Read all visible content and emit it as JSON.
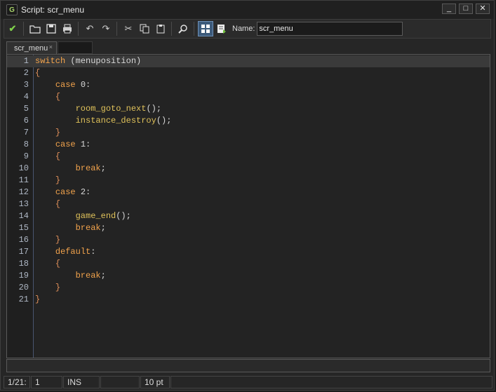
{
  "window": {
    "title": "Script: scr_menu",
    "buttons": [
      "_",
      "□",
      "✕"
    ]
  },
  "toolbar": {
    "name_label": "Name:",
    "name_value": "scr_menu"
  },
  "tabs": [
    {
      "label": "scr_menu",
      "close": "×"
    }
  ],
  "editor": {
    "current_line": 1,
    "lines": [
      {
        "n": "1",
        "text": "switch (menuposition)"
      },
      {
        "n": "2",
        "text": "{"
      },
      {
        "n": "3",
        "text": "    case 0:"
      },
      {
        "n": "4",
        "text": "    {"
      },
      {
        "n": "5",
        "text": "        room_goto_next();"
      },
      {
        "n": "6",
        "text": "        instance_destroy();"
      },
      {
        "n": "7",
        "text": "    }"
      },
      {
        "n": "8",
        "text": "    case 1:"
      },
      {
        "n": "9",
        "text": "    {"
      },
      {
        "n": "10",
        "text": "        break;"
      },
      {
        "n": "11",
        "text": "    }"
      },
      {
        "n": "12",
        "text": "    case 2:"
      },
      {
        "n": "13",
        "text": "    {"
      },
      {
        "n": "14",
        "text": "        game_end();"
      },
      {
        "n": "15",
        "text": "        break;"
      },
      {
        "n": "16",
        "text": "    }"
      },
      {
        "n": "17",
        "text": "    default:"
      },
      {
        "n": "18",
        "text": "    {"
      },
      {
        "n": "19",
        "text": "        break;"
      },
      {
        "n": "20",
        "text": "    }"
      },
      {
        "n": "21",
        "text": "}"
      }
    ]
  },
  "status": {
    "position": "1/21:",
    "column": "1",
    "mode": "INS",
    "font_size": "10 pt"
  },
  "colors": {
    "keyword": "#f2a34c",
    "brace": "#e0905a",
    "function": "#e0c25a"
  }
}
